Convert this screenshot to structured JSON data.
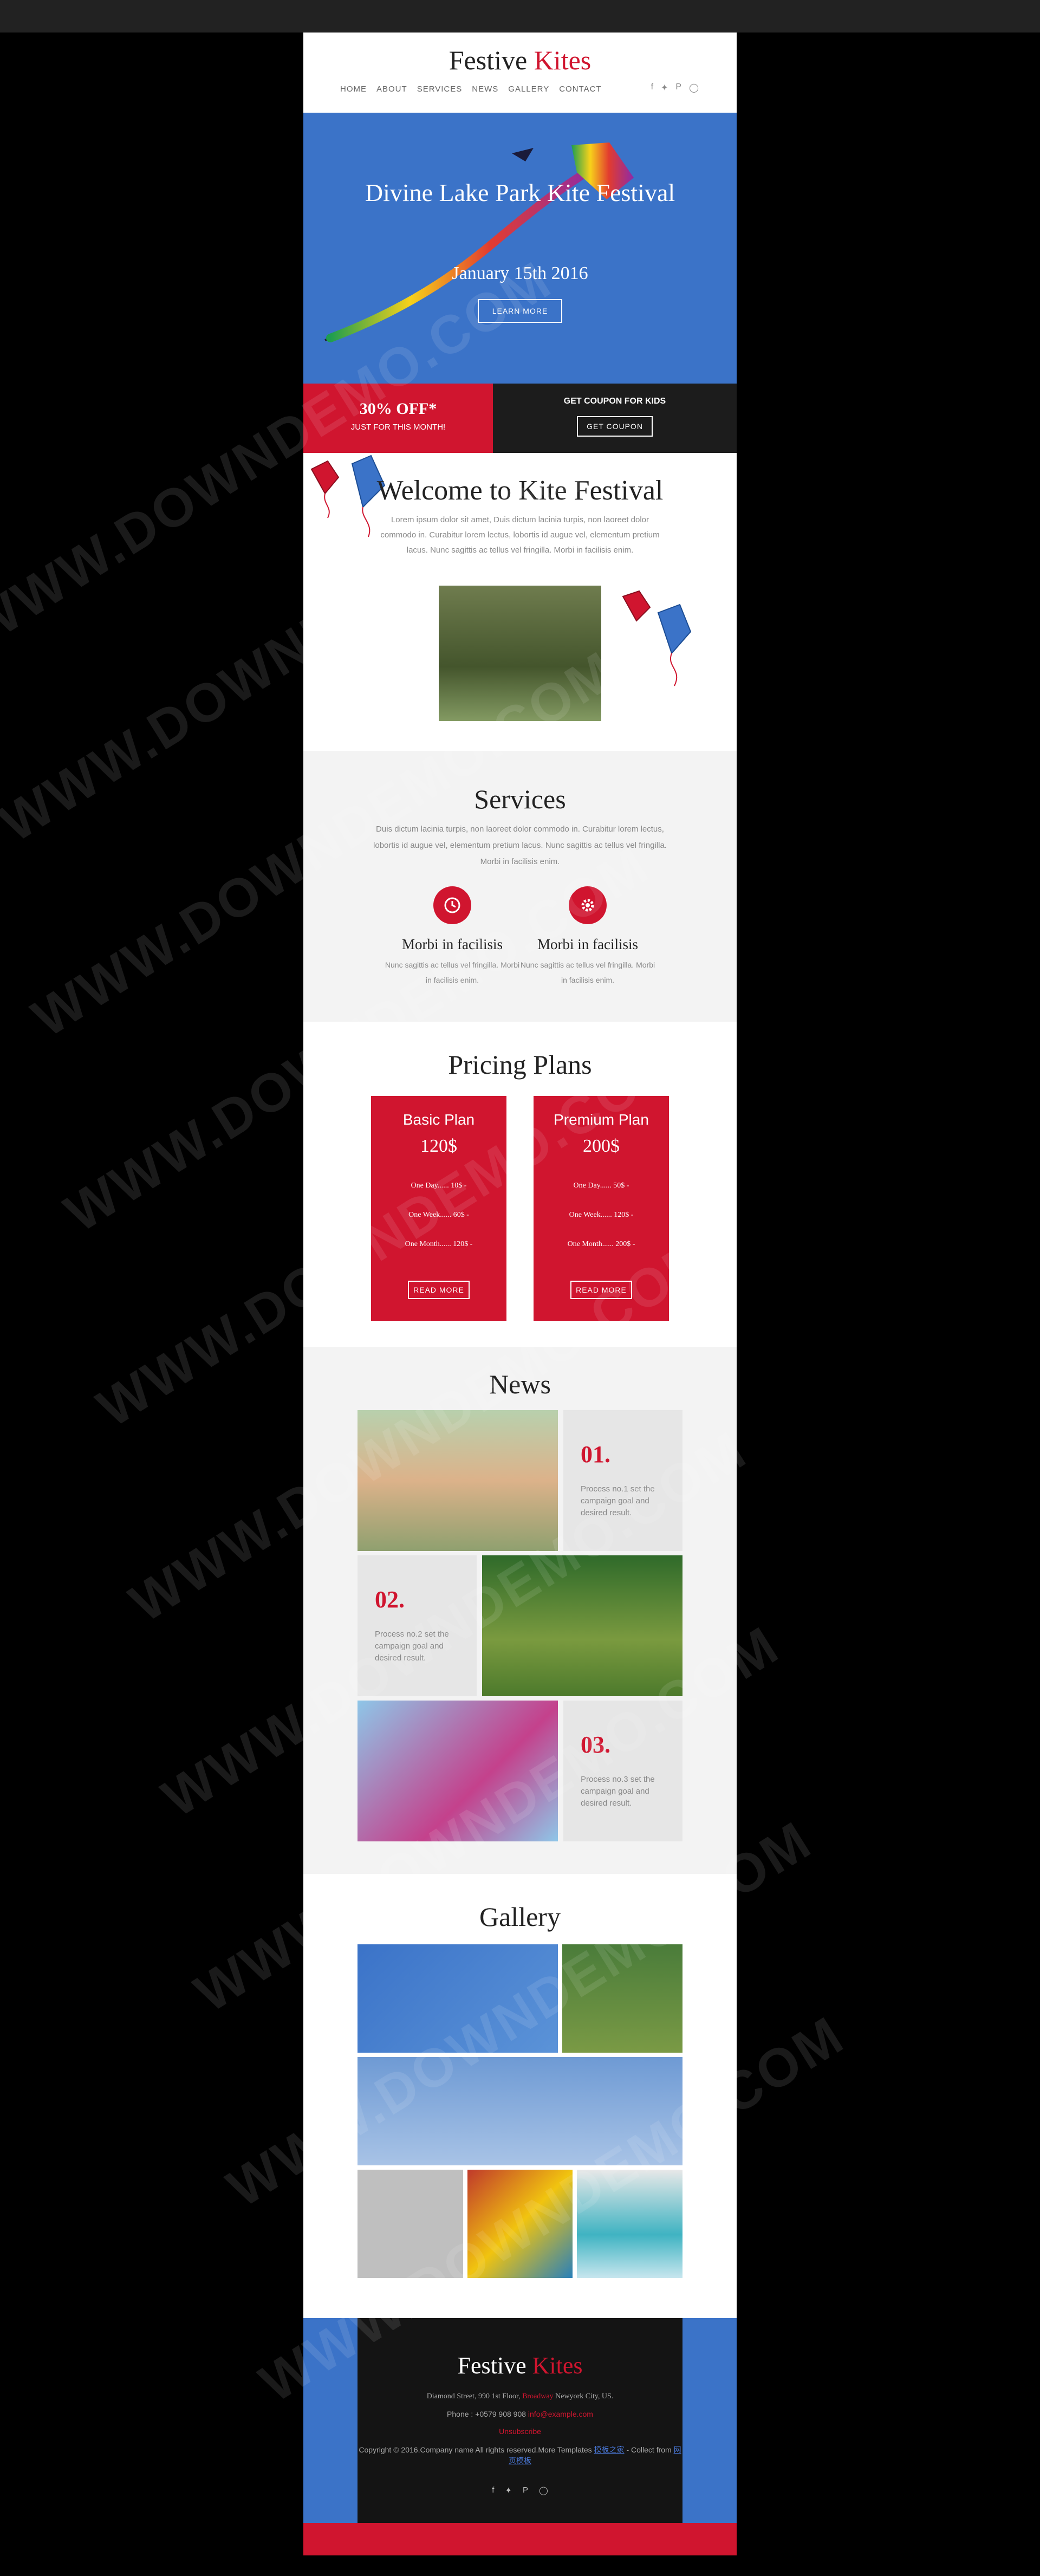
{
  "brand": {
    "name_part1": "Festive",
    "name_part2": "Kites"
  },
  "nav": [
    "HOME",
    "ABOUT",
    "SERVICES",
    "NEWS",
    "GALLERY",
    "CONTACT"
  ],
  "social_icons": [
    "facebook-icon",
    "twitter-icon",
    "pinterest-icon",
    "instagram-icon"
  ],
  "hero": {
    "title": "Divine Lake Park Kite Festival",
    "date": "January 15th 2016",
    "button": "LEARN MORE"
  },
  "coupon": {
    "offer": "30% OFF*",
    "offer_sub": "JUST FOR THIS MONTH!",
    "kids_title": "GET COUPON FOR KIDS",
    "button": "GET COUPON"
  },
  "welcome": {
    "title": "Welcome to Kite Festival",
    "text": "Lorem ipsum dolor sit amet, Duis dictum lacinia turpis, non laoreet dolor commodo in. Curabitur lorem lectus, lobortis id augue vel, elementum pretium lacus. Nunc sagittis ac tellus vel fringilla. Morbi in facilisis enim."
  },
  "services": {
    "title": "Services",
    "intro": "Duis dictum lacinia turpis, non laoreet dolor commodo in. Curabitur lorem lectus, lobortis id augue vel, elementum pretium lacus. Nunc sagittis ac tellus vel fringilla. Morbi in facilisis enim.",
    "items": [
      {
        "icon": "clock-icon",
        "title": "Morbi in facilisis",
        "text": "Nunc sagittis ac tellus vel fringilla. Morbi in facilisis enim."
      },
      {
        "icon": "gear-icon",
        "title": "Morbi in facilisis",
        "text": "Nunc sagittis ac tellus vel fringilla. Morbi in facilisis enim."
      }
    ]
  },
  "pricing": {
    "title": "Pricing Plans",
    "plans": [
      {
        "name": "Basic Plan",
        "price": "120$",
        "rows": [
          "One Day...... 10$ -",
          "One Week...... 60$ -",
          "One Month...... 120$ -"
        ],
        "button": "READ MORE"
      },
      {
        "name": "Premium Plan",
        "price": "200$",
        "rows": [
          "One Day...... 50$ -",
          "One Week...... 120$ -",
          "One Month...... 200$ -"
        ],
        "button": "READ MORE"
      }
    ]
  },
  "news": {
    "title": "News",
    "items": [
      {
        "num": "01.",
        "text": "Process no.1 set the campaign goal and desired result."
      },
      {
        "num": "02.",
        "text": "Process no.2 set the campaign goal and desired result."
      },
      {
        "num": "03.",
        "text": "Process no.3 set the campaign goal and desired result."
      }
    ]
  },
  "gallery": {
    "title": "Gallery"
  },
  "footer": {
    "address_pre": "Diamond Street, 990 1st Floor,",
    "address_link": "Broadway",
    "address_post": "Newyork City, US.",
    "phone_pre": "Phone : +0579 908 908",
    "email": "info@example.com",
    "unsubscribe": "Unsubscribe",
    "copyright_pre": "Copyright © 2016.Company name All rights reserved.More Templates",
    "copyright_link1": "模板之家",
    "copyright_mid": "- Collect from",
    "copyright_link2": "网页模板"
  },
  "watermark": "WWW.DOWNDEMO.COM",
  "colors": {
    "accent": "#d0152f",
    "hero_blue": "#3b73c8",
    "dark": "#1c1c1c"
  }
}
